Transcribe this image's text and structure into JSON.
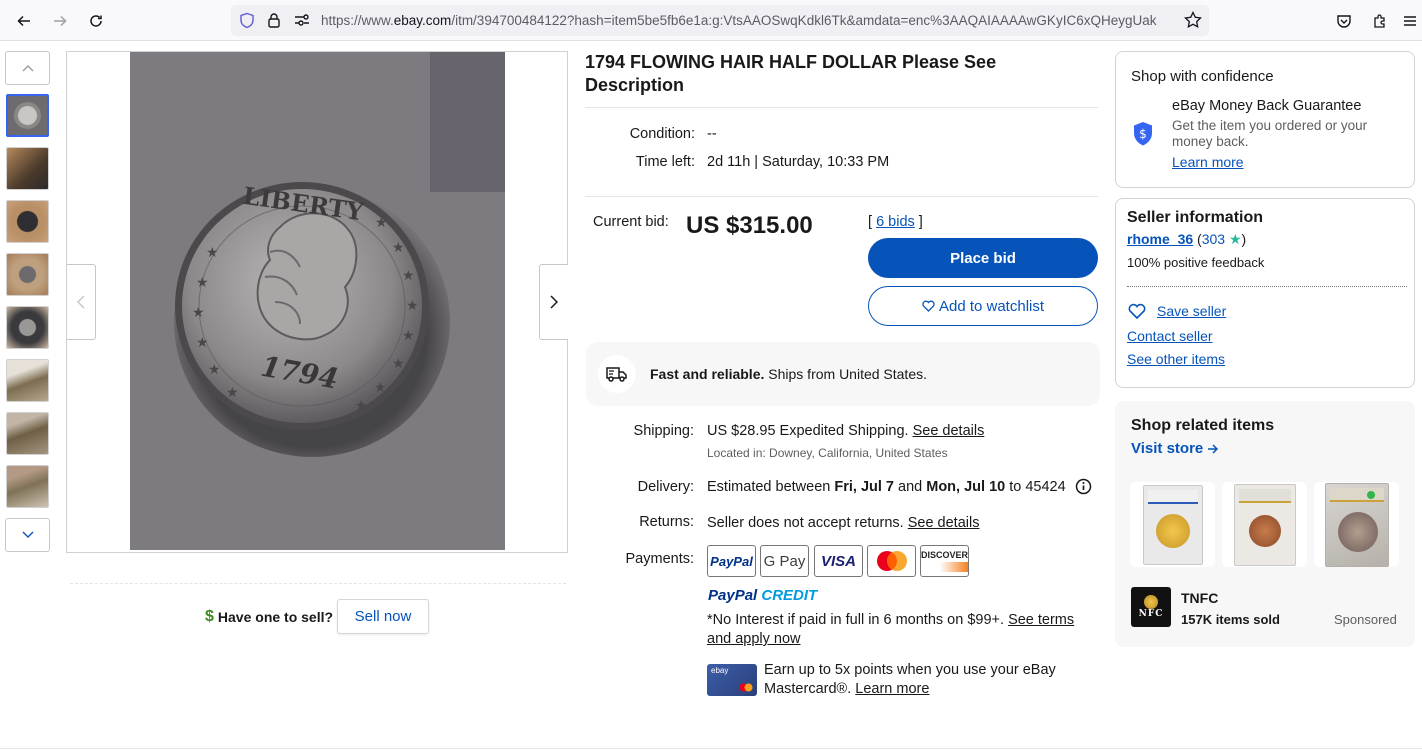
{
  "browser": {
    "url_prefix": "https://www.",
    "url_host": "ebay.com",
    "url_rest": "/itm/394700484122?hash=item5be5fb6e1a:g:VtsAAOSwqKdkl6Tk&amdata=enc%3AAQAIAAAAwGKyIC6xQHeygUak"
  },
  "listing": {
    "title": "1794 FLOWING HAIR HALF DOLLAR Please See Description",
    "condition_label": "Condition:",
    "condition_value": "--",
    "time_left_label": "Time left:",
    "time_left_value": "2d 11h | Saturday, 10:33 PM",
    "current_bid_label": "Current bid:",
    "current_bid_value": "US $315.00",
    "bids_open": "[ ",
    "bids_link": "6 bids",
    "bids_close": " ]",
    "place_bid": "Place bid",
    "add_watchlist": "Add to watchlist"
  },
  "shipping_box": {
    "bold": "Fast and reliable.",
    "text": " Ships from United States."
  },
  "details": {
    "shipping_label": "Shipping:",
    "shipping_price": "US $28.95",
    "shipping_method": " Expedited Shipping. ",
    "shipping_link": "See details",
    "shipping_location": "Located in: Downey, California, United States",
    "delivery_label": "Delivery:",
    "delivery_pre": "Estimated between ",
    "delivery_from": "Fri, Jul 7",
    "delivery_and": " and ",
    "delivery_to": "Mon, Jul 10",
    "delivery_zip": " to 45424",
    "returns_label": "Returns:",
    "returns_text": "Seller does not accept returns. ",
    "returns_link": "See details",
    "payments_label": "Payments:",
    "payment_methods": [
      "PayPal",
      "G Pay",
      "VISA",
      "Mastercard",
      "DISCOVER"
    ],
    "paypal_credit_a": "PayPal",
    "paypal_credit_b": "CREDIT",
    "credit_text": "*No Interest if paid in full in 6 months on $99+. ",
    "credit_link": "See terms and apply now",
    "card_promo": "Earn up to 5x points when you use your eBay Mastercard®. ",
    "card_promo_link": "Learn more",
    "card_brand": "ebay"
  },
  "sell": {
    "question": "Have one to sell?",
    "button": "Sell now"
  },
  "confidence": {
    "title": "Shop with confidence",
    "guarantee_title": "eBay Money Back Guarantee",
    "guarantee_text": "Get the item you ordered or your money back.",
    "learn_more": "Learn more"
  },
  "seller": {
    "title": "Seller information",
    "name": "rhome_36",
    "open": " (",
    "score": "303",
    "close": ")",
    "feedback": "100% positive feedback",
    "save": "Save seller",
    "contact": "Contact seller",
    "other_items": "See other items"
  },
  "related": {
    "title": "Shop related items",
    "visit_store": "Visit store",
    "store_name": "TNFC",
    "store_logo": "NFC",
    "items_sold": "157K items sold",
    "sponsored": "Sponsored"
  },
  "coin": {
    "legend": "LIBERTY",
    "year": "1794"
  },
  "colors": {
    "primary_blue": "#0654ba",
    "active_thumb": "#3665f3",
    "text": "#191919"
  }
}
